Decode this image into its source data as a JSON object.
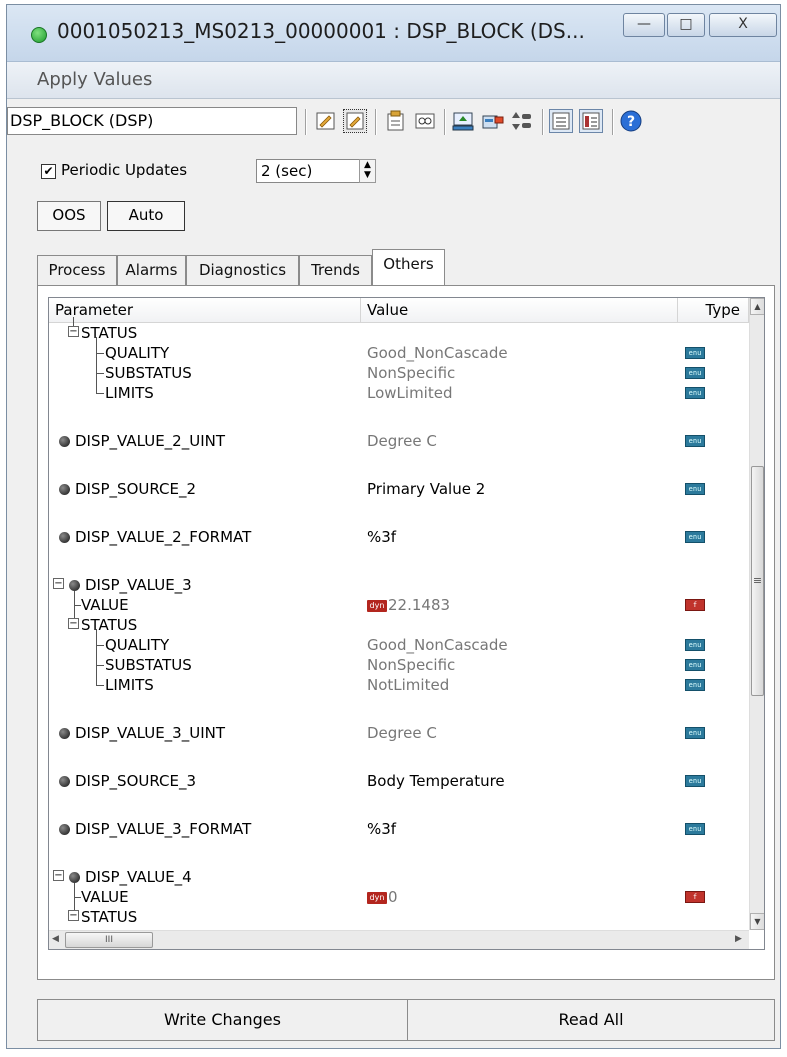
{
  "window": {
    "title": "0001050213_MS0213_00000001 : DSP_BLOCK (DS...",
    "minimize": "—",
    "maximize": "□",
    "close": "X"
  },
  "menu": {
    "apply_values": "Apply Values"
  },
  "toolbar": {
    "block_name": "DSP_BLOCK (DSP)",
    "help": "?"
  },
  "periodic": {
    "label": "Periodic Updates",
    "checked_mark": "✔",
    "interval": "2 (sec)"
  },
  "mode": {
    "oos": "OOS",
    "auto": "Auto"
  },
  "tabs": [
    "Process",
    "Alarms",
    "Diagnostics",
    "Trends",
    "Others"
  ],
  "grid": {
    "columns": {
      "parameter": "Parameter",
      "value": "Value",
      "type": "Type"
    },
    "rows": [
      {
        "name": "STATUS",
        "value": "",
        "type": ""
      },
      {
        "name": "QUALITY",
        "value": "Good_NonCascade",
        "type": "enu"
      },
      {
        "name": "SUBSTATUS",
        "value": "NonSpecific",
        "type": "enu"
      },
      {
        "name": "LIMITS",
        "value": "LowLimited",
        "type": "enu"
      },
      {
        "name": "DISP_VALUE_2_UINT",
        "value": "Degree C",
        "type": "enu"
      },
      {
        "name": "DISP_SOURCE_2",
        "value": "Primary Value 2",
        "type": "enu"
      },
      {
        "name": "DISP_VALUE_2_FORMAT",
        "value": "%3f",
        "type": "enu"
      },
      {
        "name": "DISP_VALUE_3",
        "value": "",
        "type": ""
      },
      {
        "name": "VALUE",
        "value": "22.1483",
        "dyn": "dyn",
        "type": "f"
      },
      {
        "name": "STATUS",
        "value": "",
        "type": ""
      },
      {
        "name": "QUALITY",
        "value": "Good_NonCascade",
        "type": "enu"
      },
      {
        "name": "SUBSTATUS",
        "value": "NonSpecific",
        "type": "enu"
      },
      {
        "name": "LIMITS",
        "value": "NotLimited",
        "type": "enu"
      },
      {
        "name": "DISP_VALUE_3_UINT",
        "value": "Degree C",
        "type": "enu"
      },
      {
        "name": "DISP_SOURCE_3",
        "value": "Body Temperature",
        "type": "enu"
      },
      {
        "name": "DISP_VALUE_3_FORMAT",
        "value": "%3f",
        "type": "enu"
      },
      {
        "name": "DISP_VALUE_4",
        "value": "",
        "type": ""
      },
      {
        "name": "VALUE",
        "value": "0",
        "dyn": "dyn",
        "type": "f"
      },
      {
        "name": "STATUS",
        "value": "",
        "type": ""
      }
    ],
    "expand_minus": "−",
    "scroll_up": "▲",
    "scroll_down": "▼",
    "scroll_left": "◀",
    "scroll_right": "▶",
    "thumb_grip": "≡",
    "hthumb_grip": "III"
  },
  "buttons": {
    "write": "Write Changes",
    "read": "Read All"
  }
}
